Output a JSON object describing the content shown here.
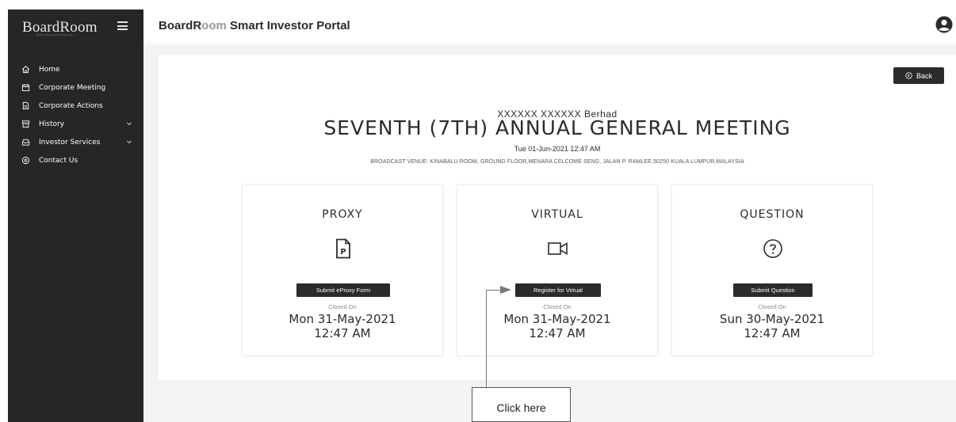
{
  "app": {
    "logo": "BoardRoom",
    "logo_tagline": "Smart Business Solutions",
    "portal_title_strong": "BoardR",
    "portal_title_dim": "oom",
    "portal_title_rest": " Smart Investor Portal"
  },
  "sidebar": {
    "items": [
      {
        "label": "Home",
        "icon": "home-icon"
      },
      {
        "label": "Corporate Meeting",
        "icon": "calendar-icon"
      },
      {
        "label": "Corporate Actions",
        "icon": "document-icon"
      },
      {
        "label": "History",
        "icon": "history-icon",
        "expandable": true
      },
      {
        "label": "Investor Services",
        "icon": "inbox-icon",
        "expandable": true
      },
      {
        "label": "Contact Us",
        "icon": "location-icon"
      }
    ]
  },
  "toolbar": {
    "back_label": "Back"
  },
  "meeting": {
    "company": "XXXXXX XXXXXX Berhad",
    "title": "SEVENTH (7TH) ANNUAL GENERAL MEETING",
    "datetime": "Tue 01-Jun-2021 12:47 AM",
    "venue": "BROADCAST VENUE: KINABALU ROOM, GROUND FLOOR,MENARA CELCOME SENG, JALAN P. RAMLEE,50250 KUALA LUMPUR,MALAYSIA"
  },
  "options": [
    {
      "title": "PROXY",
      "icon": "proxy-file-icon",
      "button": "Submit eProxy Form",
      "closed_label": "Closed On",
      "date": "Mon 31-May-2021",
      "time": "12:47 AM"
    },
    {
      "title": "VIRTUAL",
      "icon": "video-camera-icon",
      "button": "Register for Virtual",
      "closed_label": "Closed On",
      "date": "Mon 31-May-2021",
      "time": "12:47 AM"
    },
    {
      "title": "QUESTION",
      "icon": "question-circle-icon",
      "button": "Submit Question",
      "closed_label": "Closed On",
      "date": "Sun 30-May-2021",
      "time": "12:47 AM"
    }
  ],
  "callout": {
    "text": "Click here"
  },
  "colors": {
    "sidebar_bg": "#262626",
    "button_bg": "#2b2b2b",
    "page_bg": "#f3f3f3"
  }
}
